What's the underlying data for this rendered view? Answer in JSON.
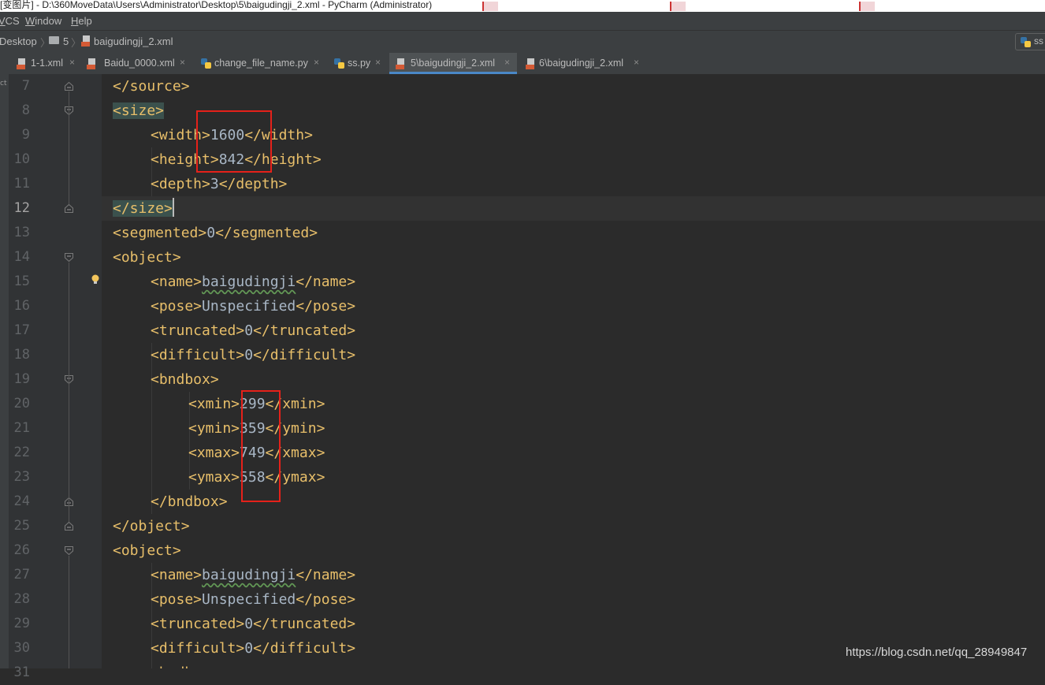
{
  "window": {
    "title": "[变图片] - D:\\360MoveData\\Users\\Administrator\\Desktop\\5\\baigudingji_2.xml - PyCharm (Administrator)"
  },
  "menu": {
    "items": [
      {
        "label": "VCS",
        "mnemonic": "V"
      },
      {
        "label": "Window",
        "mnemonic": "W"
      },
      {
        "label": "Help",
        "mnemonic": "H"
      }
    ]
  },
  "breadcrumb": {
    "items": [
      "Desktop",
      "5",
      "baigudingji_2.xml"
    ],
    "right_label": "ss"
  },
  "tabs": [
    {
      "label": "1-1.xml",
      "icon": "xml-file-icon",
      "active": false
    },
    {
      "label": "Baidu_0000.xml",
      "icon": "xml-file-icon",
      "active": false
    },
    {
      "label": "change_file_name.py",
      "icon": "python-file-icon",
      "active": false
    },
    {
      "label": "ss.py",
      "icon": "python-file-icon",
      "active": false
    },
    {
      "label": "5\\baigudingji_2.xml",
      "icon": "xml-file-icon",
      "active": true
    },
    {
      "label": "6\\baigudingji_2.xml",
      "icon": "xml-file-icon",
      "active": false
    }
  ],
  "tab_close_glyph": "×",
  "side_panel_label": "ct",
  "editor": {
    "current_line": 12,
    "lines": [
      {
        "n": 7,
        "text": "</source>"
      },
      {
        "n": 8,
        "text": "<size>"
      },
      {
        "n": 9,
        "text": "<width>1600</width>"
      },
      {
        "n": 10,
        "text": "<height>842</height>"
      },
      {
        "n": 11,
        "text": "<depth>3</depth>"
      },
      {
        "n": 12,
        "text": "</size>"
      },
      {
        "n": 13,
        "text": "<segmented>0</segmented>"
      },
      {
        "n": 14,
        "text": "<object>"
      },
      {
        "n": 15,
        "text": "<name>baigudingji</name>"
      },
      {
        "n": 16,
        "text": "<pose>Unspecified</pose>"
      },
      {
        "n": 17,
        "text": "<truncated>0</truncated>"
      },
      {
        "n": 18,
        "text": "<difficult>0</difficult>"
      },
      {
        "n": 19,
        "text": "<bndbox>"
      },
      {
        "n": 20,
        "text": "<xmin>299</xmin>"
      },
      {
        "n": 21,
        "text": "<ymin>359</ymin>"
      },
      {
        "n": 22,
        "text": "<xmax>749</xmax>"
      },
      {
        "n": 23,
        "text": "<ymax>558</ymax>"
      },
      {
        "n": 24,
        "text": "</bndbox>"
      },
      {
        "n": 25,
        "text": "</object>"
      },
      {
        "n": 26,
        "text": "<object>"
      },
      {
        "n": 27,
        "text": "<name>baigudingji</name>"
      },
      {
        "n": 28,
        "text": "<pose>Unspecified</pose>"
      },
      {
        "n": 29,
        "text": "<truncated>0</truncated>"
      },
      {
        "n": 30,
        "text": "<difficult>0</difficult>"
      },
      {
        "n": 31,
        "text": "<bndbox>"
      }
    ]
  },
  "colors": {
    "tag": "#e8bf6a",
    "text": "#a9b7c6",
    "background": "#2b2b2b",
    "annotation": "#e5211a",
    "active_tab_underline": "#4a88c7"
  },
  "watermark": "https://blog.csdn.net/qq_28949847"
}
